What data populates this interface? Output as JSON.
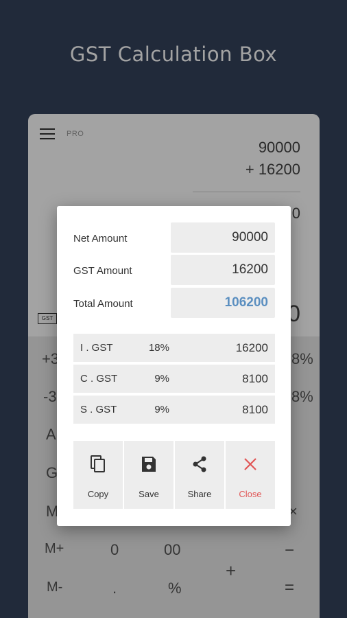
{
  "headline": "GST Calculation Box",
  "calculator": {
    "pro_label": "PRO",
    "expression_line1": "90000",
    "expression_line2": "+  16200",
    "result_partial": "0",
    "big_result_partial": "0",
    "gst_icon_label": "GST",
    "keys": {
      "plus3": "+3",
      "minus3": "-3",
      "a": "A",
      "g": "G",
      "m": "M",
      "mplus": "M+",
      "mminus": "M-",
      "zero": "0",
      "double_zero": "00",
      "dot": ".",
      "percent": "%",
      "plus": "+",
      "minus": "−",
      "equals": "=",
      "pct_right1": "8%",
      "pct_right2": "8%",
      "times": "×"
    }
  },
  "dialog": {
    "net_amount_label": "Net Amount",
    "net_amount_value": "90000",
    "gst_amount_label": "GST Amount",
    "gst_amount_value": "16200",
    "total_amount_label": "Total Amount",
    "total_amount_value": "106200",
    "breakdown": [
      {
        "name": "I . GST",
        "rate": "18%",
        "amount": "16200"
      },
      {
        "name": "C . GST",
        "rate": "9%",
        "amount": "8100"
      },
      {
        "name": "S . GST",
        "rate": "9%",
        "amount": "8100"
      }
    ],
    "actions": {
      "copy": "Copy",
      "save": "Save",
      "share": "Share",
      "close": "Close"
    }
  },
  "colors": {
    "background": "#35435c",
    "total_accent": "#5b8fc0",
    "close_accent": "#e15656"
  }
}
